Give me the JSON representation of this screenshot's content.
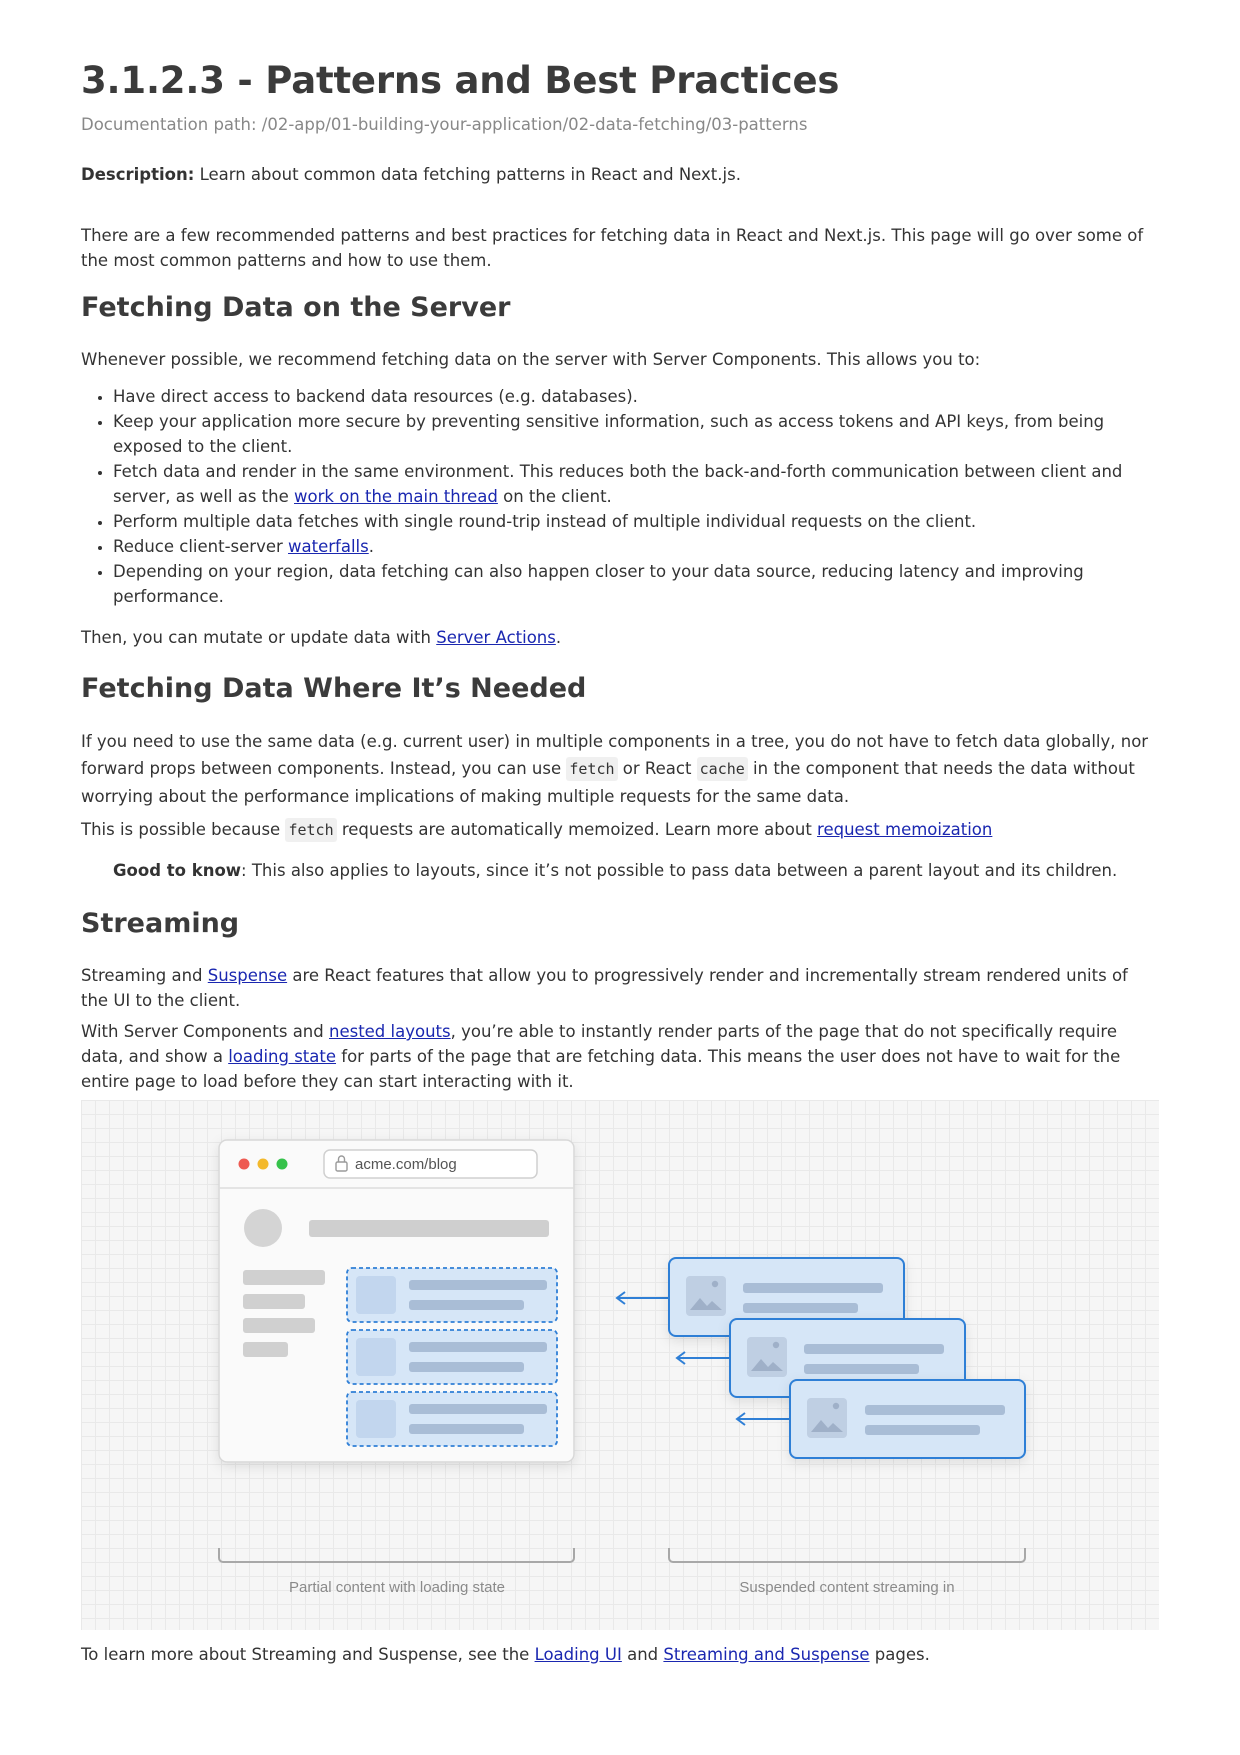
{
  "title": "3.1.2.3 - Patterns and Best Practices",
  "doc_path": "Documentation path: /02-app/01-building-your-application/02-data-fetching/03-patterns",
  "description": {
    "label": "Description:",
    "text": " Learn about common data fetching patterns in React and Next.js."
  },
  "intro": "There are a few recommended patterns and best practices for fetching data in React and Next.js. This page will go over some of the most common patterns and how to use them.",
  "section_server": {
    "heading": "Fetching Data on the Server",
    "lead": "Whenever possible, we recommend fetching data on the server with Server Components. This allows you to:",
    "bullet1": "Have direct access to backend data resources (e.g. databases).",
    "bullet2": "Keep your application more secure by preventing sensitive information, such as access tokens and API keys, from being exposed to the client.",
    "bullet3_a": "Fetch data and render in the same environment. This reduces both the back-and-forth communication between client and server, as well as the ",
    "bullet3_link": "work on the main thread",
    "bullet3_b": " on the client.",
    "bullet4": "Perform multiple data fetches with single round-trip instead of multiple individual requests on the client.",
    "bullet5_a": "Reduce client-server ",
    "bullet5_link": "waterfalls",
    "bullet5_b": ".",
    "bullet6": "Depending on your region, data fetching can also happen closer to your data source, reducing latency and improving performance.",
    "then_a": "Then, you can mutate or update data with ",
    "then_link": "Server Actions",
    "then_b": "."
  },
  "section_needed": {
    "heading": "Fetching Data Where It’s Needed",
    "p1_a": "If you need to use the same data (e.g. current user) in multiple components in a tree, you do not have to fetch data globally, nor forward props between components. Instead, you can use ",
    "p1_code1": "fetch",
    "p1_b": " or React ",
    "p1_code2": "cache",
    "p1_c": " in the component that needs the data without worrying about the performance implications of making multiple requests for the same data.",
    "p2_a": "This is possible because ",
    "p2_code": "fetch",
    "p2_b": " requests are automatically memoized. Learn more about ",
    "p2_link": "request memoization",
    "note_label": "Good to know",
    "note_text": ": This also applies to layouts, since it’s not possible to pass data between a parent layout and its children."
  },
  "section_streaming": {
    "heading": "Streaming",
    "p1_a": "Streaming and ",
    "p1_link": "Suspense",
    "p1_b": " are React features that allow you to progressively render and incrementally stream rendered units of the UI to the client.",
    "p2_a": "With Server Components and ",
    "p2_link1": "nested layouts",
    "p2_b": ", you’re able to instantly render parts of the page that do not specifically require data, and show a ",
    "p2_link2": "loading state",
    "p2_c": " for parts of the page that are fetching data. This means the user does not have to wait for the entire page to load before they can start interacting with it.",
    "p3_a": "To learn more about Streaming and Suspense, see the ",
    "p3_link1": "Loading UI",
    "p3_b": " and ",
    "p3_link2": "Streaming and Suspense",
    "p3_c": " pages."
  },
  "figure": {
    "url": "acme.com/blog",
    "left_caption": "Partial content with loading state",
    "right_caption": "Suspended content streaming in",
    "colors": {
      "accent": "#2f7fd6",
      "card_fill": "#d6e6f7",
      "skeleton": "#cfcfcf",
      "dot_red": "#ee5a52",
      "dot_yellow": "#f3b92c",
      "dot_green": "#36c24b"
    }
  }
}
